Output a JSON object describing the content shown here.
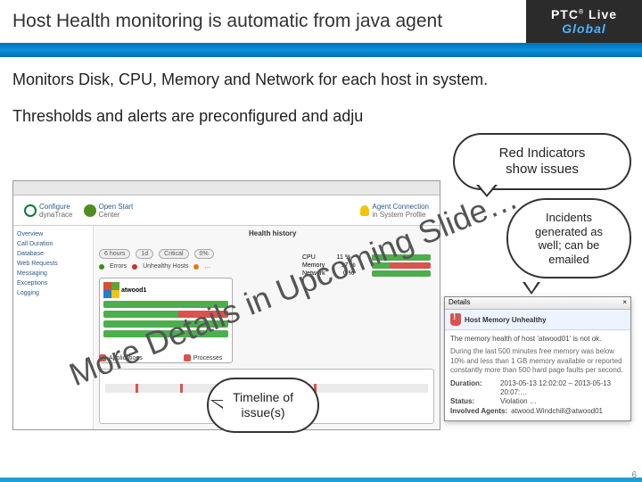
{
  "header": {
    "title": "Host Health monitoring is automatic from java agent",
    "brand_top": "PTC",
    "brand_mid": "Live",
    "brand_bottom": "Global"
  },
  "body": {
    "line1": "Monitors Disk, CPU, Memory and Network for each host in system.",
    "line2": "Thresholds and alerts are preconfigured and adju"
  },
  "callouts": {
    "c1a": "Red Indicators",
    "c1b": "show issues",
    "c2a": "Incidents",
    "c2b": "generated as",
    "c2c": "well; can be",
    "c2d": "emailed",
    "c3a": "Timeline of",
    "c3b": "issue(s)"
  },
  "watermark": "More Details in Upcoming Slide…",
  "screenshot": {
    "toolbar": {
      "configure": "Configure",
      "subtitle": "dynaTrace",
      "openstart": "Open Start",
      "center": "Center",
      "agent": "Agent Connection",
      "profile": "in System Profile"
    },
    "host_label": "atwood1",
    "nav": [
      "Overview",
      "Call Duration",
      "Database",
      "Web Requests",
      "Messaging",
      "Exceptions",
      "Logging"
    ],
    "tabs": {
      "hours": "6 hours",
      "day": "1d",
      "critical": "Critical",
      "db": "0%"
    },
    "bullets": {
      "a": "Errors",
      "b": "Unhealthy Hosts",
      "c": "…"
    },
    "metric": {
      "host": "atwood1"
    },
    "health": {
      "title": "Health history",
      "cpu": "CPU",
      "cpu_v": "11 %",
      "mem": "Memory",
      "mem_v": "97 %",
      "net": "Network",
      "net_v": "0 %"
    },
    "bottom": {
      "apps": "Applications",
      "procs": "Processes"
    }
  },
  "popup": {
    "bar_title": "Details",
    "bar_close": "×",
    "header": "Host Memory Unhealthy",
    "line1": "The memory health of host 'atwood01' is not ok.",
    "line2": "During the last 500 minutes free memory was below 10% and less than 1 GB memory available or reported constantly more than 500 hard page faults per second.",
    "duration_k": "Duration:",
    "duration_v": "2013-05-13 12:02:02 – 2013-05-13 20:07:…",
    "status_k": "Status:",
    "status_v": "Violation …",
    "agent_k": "Involved Agents:",
    "agent_v": "atwood.Windchill@atwood01"
  },
  "page_number": "6"
}
